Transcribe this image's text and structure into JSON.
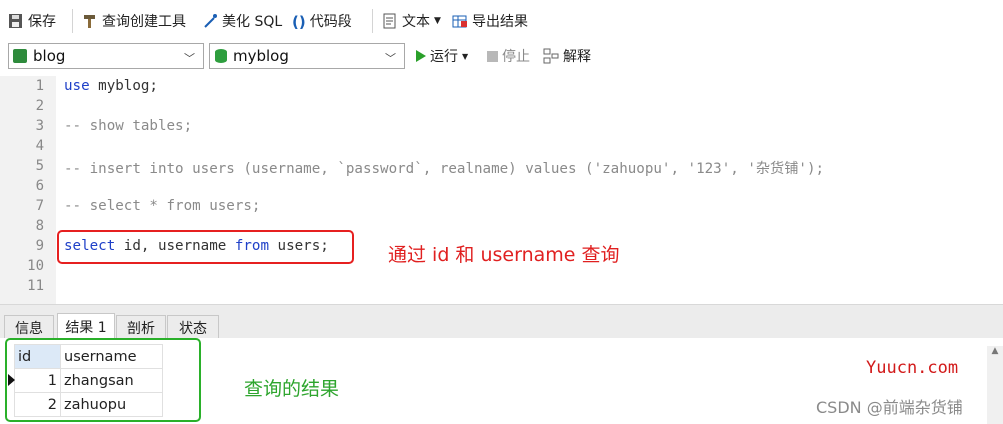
{
  "toolbar": {
    "save_label": "保存",
    "query_builder_label": "查询创建工具",
    "beautify_label": "美化 SQL",
    "snippet_label": "代码段",
    "text_label": "文本",
    "export_label": "导出结果"
  },
  "connection_bar": {
    "connection": "blog",
    "database": "myblog",
    "run_label": "运行",
    "stop_label": "停止",
    "explain_label": "解释"
  },
  "editor": {
    "line_numbers": [
      "1",
      "2",
      "3",
      "4",
      "5",
      "6",
      "7",
      "8",
      "9",
      "10",
      "11"
    ],
    "line1_kw": "use",
    "line1_rest": " myblog;",
    "line3": "-- show tables;",
    "line5": "-- insert into users (username, `password`, realname) values ('zahuopu', '123', '杂货铺');",
    "line7": "-- select * from users;",
    "line9_kw1": "select",
    "line9_mid": " id, username ",
    "line9_kw2": "from",
    "line9_rest": " users;"
  },
  "annotations": {
    "query_note": "通过 id 和 username 查询",
    "result_note": "查询的结果"
  },
  "result_tabs": [
    "信息",
    "结果 1",
    "剖析",
    "状态"
  ],
  "result_grid": {
    "columns": [
      "id",
      "username"
    ],
    "rows": [
      [
        "1",
        "zhangsan"
      ],
      [
        "2",
        "zahuopu"
      ]
    ]
  },
  "watermarks": {
    "site": "Yuucn.com",
    "csdn": "CSDN @前端杂货铺"
  },
  "colors": {
    "keyword": "#1f40c8",
    "comment": "#8a8a8a",
    "red_annotation": "#e02020",
    "green_annotation": "#2ea52e"
  }
}
